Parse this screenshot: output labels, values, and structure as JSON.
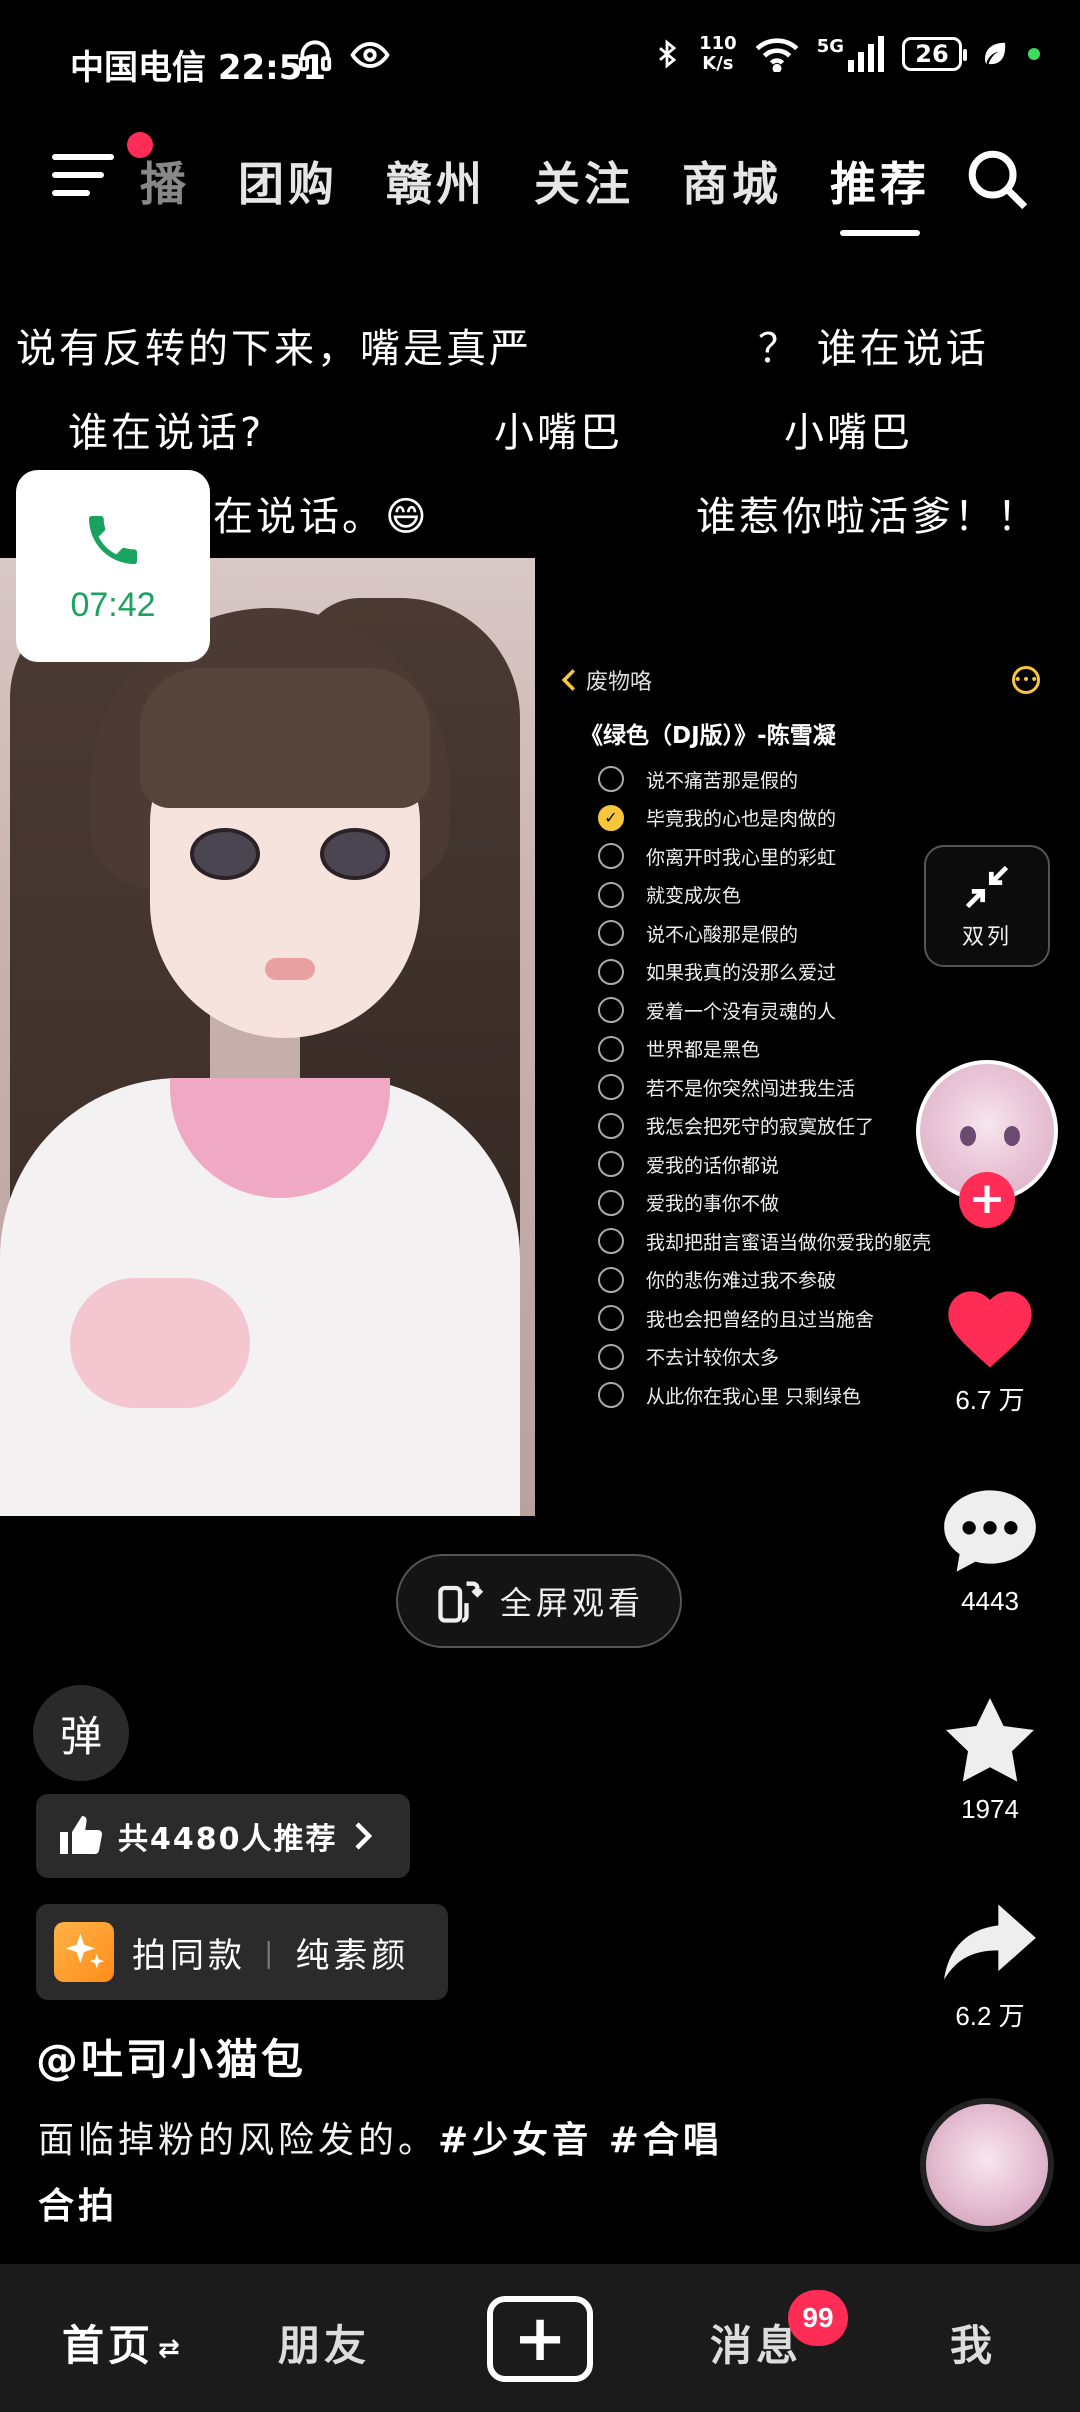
{
  "status_bar": {
    "carrier_time": "中国电信 22:51",
    "net_speed_value": "110",
    "net_speed_unit": "K/s",
    "signal_label": "5G",
    "battery": "26"
  },
  "top_nav": {
    "tabs": [
      {
        "label": "播"
      },
      {
        "label": "团购"
      },
      {
        "label": "赣州"
      },
      {
        "label": "关注"
      },
      {
        "label": "商城"
      },
      {
        "label": "推荐"
      }
    ]
  },
  "danmaku": [
    "说有反转的下来，嘴是真严",
    "？ 谁在说话",
    "谁在说话?",
    "小嘴巴",
    "小嘴巴",
    "谁在说话。😄",
    "谁惹你啦活爹！！"
  ],
  "call": {
    "time": "07:42"
  },
  "lyrics": {
    "back_label": "废物咯",
    "title": "《绿色（DJ版）》-陈雪凝",
    "lines": [
      {
        "text": "说不痛苦那是假的",
        "checked": false
      },
      {
        "text": "毕竟我的心也是肉做的",
        "checked": true
      },
      {
        "text": "你离开时我心里的彩虹",
        "checked": false
      },
      {
        "text": "就变成灰色",
        "checked": false
      },
      {
        "text": "说不心酸那是假的",
        "checked": false
      },
      {
        "text": "如果我真的没那么爱过",
        "checked": false
      },
      {
        "text": "爱着一个没有灵魂的人",
        "checked": false
      },
      {
        "text": "世界都是黑色",
        "checked": false
      },
      {
        "text": "若不是你突然闯进我生活",
        "checked": false
      },
      {
        "text": "我怎会把死守的寂寞放任了",
        "checked": false
      },
      {
        "text": "爱我的话你都说",
        "checked": false
      },
      {
        "text": "爱我的事你不做",
        "checked": false
      },
      {
        "text": "我却把甜言蜜语当做你爱我的躯壳",
        "checked": false
      },
      {
        "text": "你的悲伤难过我不参破",
        "checked": false
      },
      {
        "text": "我也会把曾经的且过当施舍",
        "checked": false
      },
      {
        "text": "不去计较你太多",
        "checked": false
      },
      {
        "text": "从此你在我心里 只剩绿色",
        "checked": false
      }
    ]
  },
  "rail": {
    "dual_label": "双列",
    "likes": "6.7 万",
    "comments": "4443",
    "favorites": "1974",
    "shares": "6.2 万"
  },
  "fullscreen_label": "全屏观看",
  "danmu_label": "弹",
  "recommend_label": "共4480人推荐",
  "same_style": {
    "label": "拍同款",
    "sub": "纯素颜"
  },
  "author": "@吐司小猫包",
  "caption": {
    "text": "面临掉粉的风险发的。",
    "tags": "#少女音 #合唱",
    "line2": "合拍"
  },
  "bottom_bar": {
    "home": "首页",
    "friends": "朋友",
    "messages": "消息",
    "me": "我",
    "badge": "99"
  },
  "colors": {
    "accent_red": "#ff2d55",
    "lyric_yellow": "#f6c63c",
    "call_green": "#1aa260"
  }
}
